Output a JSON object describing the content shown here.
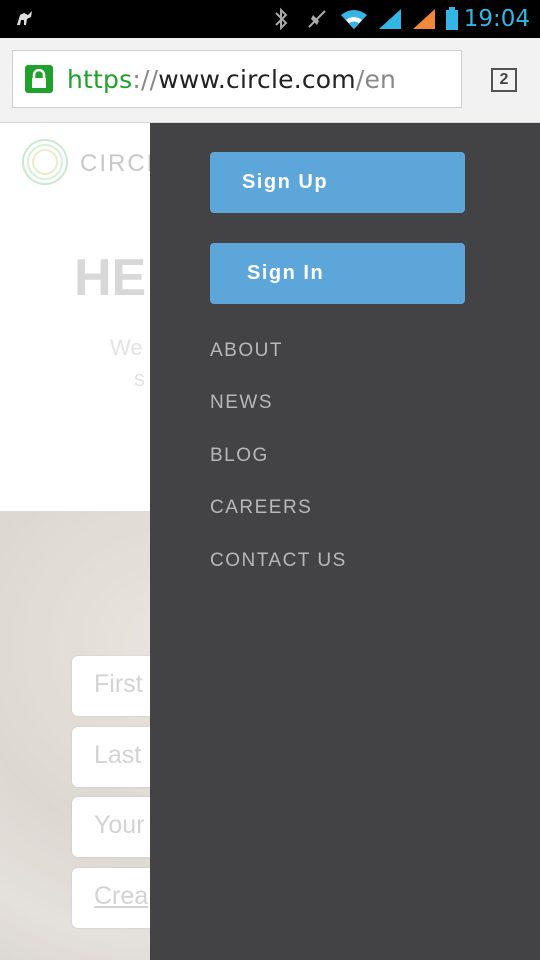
{
  "status_bar": {
    "time": "19:04",
    "icons": [
      "android-icon",
      "bluetooth-icon",
      "mute-icon",
      "wifi-icon",
      "signal-icon",
      "signal-icon-2",
      "battery-icon"
    ]
  },
  "browser": {
    "url_scheme": "https",
    "url_sep": "://",
    "url_host": "www.circle.com",
    "url_path": "/en",
    "tab_count": "2"
  },
  "page": {
    "logo_text": "CIRCLE",
    "hero_title": "HE",
    "hero_line1": "We",
    "hero_line2": "s",
    "form_fields": [
      "First",
      "Last",
      "Your",
      "Crea"
    ]
  },
  "drawer": {
    "sign_up": "Sign Up",
    "sign_in": "Sign In",
    "nav": [
      "ABOUT",
      "NEWS",
      "BLOG",
      "CAREERS",
      "CONTACT US"
    ]
  },
  "colors": {
    "drawer_bg": "#434345",
    "button_bg": "#5da6da",
    "secure_green": "#1fa12b",
    "status_blue": "#33b5e5"
  }
}
